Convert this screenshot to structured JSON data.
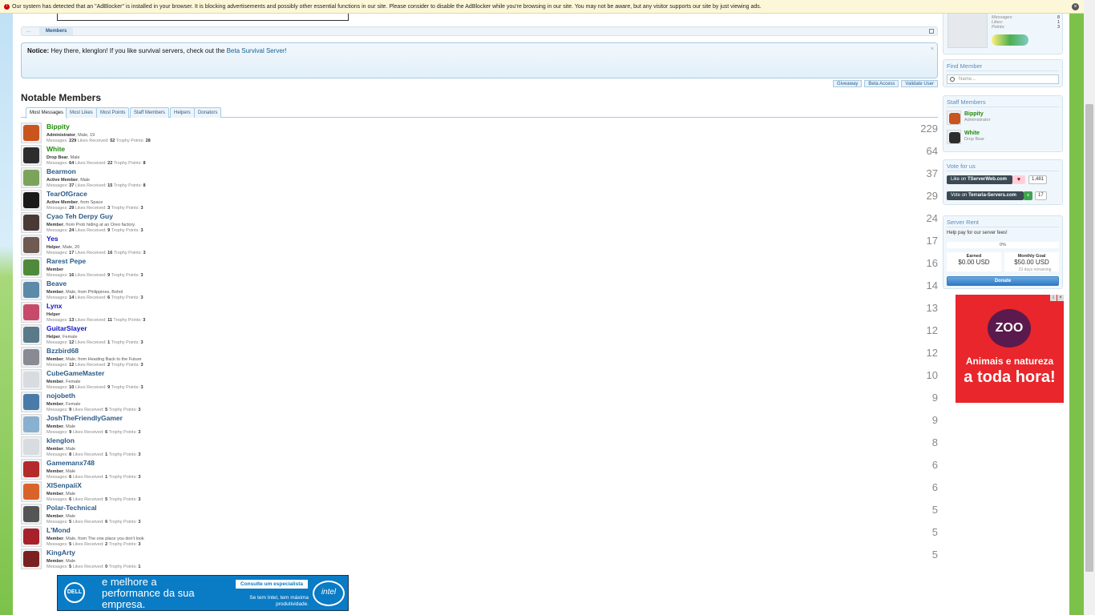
{
  "adblock_notice": "Our system has detected that an \"AdBlocker\" is installed in your browser. It is blocking advertisements and possibly other essential functions in our site. Please consider to disable the AdBlocker while you're browsing in our site. You may not be aware, but any visitor supports our site by just viewing ads.",
  "breadcrumb": {
    "home": "...",
    "current": "Members"
  },
  "notice": {
    "label": "Notice:",
    "text": "Hey there, klenglon! If you like survival servers, check out the",
    "link": "Beta Survival Server!"
  },
  "links": [
    "Giveaway",
    "Beta Access",
    "Validate User"
  ],
  "page_title": "Notable Members",
  "tabs": [
    "Most Messages",
    "Most Likes",
    "Most Points",
    "Staff Members",
    "Helpers",
    "Donators"
  ],
  "stat_labels": {
    "messages": "Messages:",
    "likes": "Likes Received:",
    "points": "Trophy Points:"
  },
  "members": [
    {
      "name": "Bippity",
      "role": "admin",
      "title": "Administrator",
      "info": ", Male, 19",
      "messages": "229",
      "likes": "52",
      "points": "28",
      "score": "229",
      "color": "#c9541d"
    },
    {
      "name": "White",
      "role": "staff",
      "title": "Drop Bear",
      "info": ", Male",
      "messages": "64",
      "likes": "22",
      "points": "8",
      "score": "64",
      "color": "#2d2d2d"
    },
    {
      "name": "Bearmon",
      "role": "member",
      "title": "Active Member",
      "info": ", Male",
      "messages": "37",
      "likes": "15",
      "points": "8",
      "score": "37",
      "color": "#7ba45a"
    },
    {
      "name": "TearOfGrace",
      "role": "member",
      "title": "Active Member",
      "info": ", from Space",
      "messages": "29",
      "likes": "3",
      "points": "3",
      "score": "29",
      "color": "#1a1a1a"
    },
    {
      "name": "Cyao Teh Derpy Guy",
      "role": "member",
      "title": "Member",
      "info": ", from Prob hiding at an Oreo factory.",
      "messages": "24",
      "likes": "9",
      "points": "3",
      "score": "24",
      "color": "#4a3a35"
    },
    {
      "name": "Yes",
      "role": "helper",
      "title": "Helper",
      "info": ", Male, 20",
      "messages": "17",
      "likes": "16",
      "points": "3",
      "score": "17",
      "color": "#6e5a52"
    },
    {
      "name": "Rarest Pepe",
      "role": "member",
      "title": "Member",
      "info": "",
      "messages": "16",
      "likes": "9",
      "points": "3",
      "score": "16",
      "color": "#4f8a3a"
    },
    {
      "name": "Beave",
      "role": "member",
      "title": "Member",
      "info": ", Male, from Philippines, Bohol",
      "messages": "14",
      "likes": "6",
      "points": "3",
      "score": "14",
      "color": "#5c8aa8"
    },
    {
      "name": "Lynx",
      "role": "helper",
      "title": "Helper",
      "info": "",
      "messages": "13",
      "likes": "11",
      "points": "3",
      "score": "13",
      "color": "#c84a6a"
    },
    {
      "name": "GuitarSlayer",
      "role": "helper",
      "title": "Helper",
      "info": ", Female",
      "messages": "12",
      "likes": "1",
      "points": "3",
      "score": "12",
      "color": "#5a7a8a"
    },
    {
      "name": "Bzzbird68",
      "role": "member",
      "title": "Member",
      "info": ", Male, from Heading Back to the Future",
      "messages": "12",
      "likes": "2",
      "points": "3",
      "score": "12",
      "color": "#8a8a95"
    },
    {
      "name": "CubeGameMaster",
      "role": "member",
      "title": "Member",
      "info": ", Female",
      "messages": "10",
      "likes": "9",
      "points": "3",
      "score": "10",
      "color": "#d8dce0"
    },
    {
      "name": "nojobeth",
      "role": "member",
      "title": "Member",
      "info": ", Female",
      "messages": "9",
      "likes": "5",
      "points": "3",
      "score": "9",
      "color": "#4a7aa8"
    },
    {
      "name": "JoshTheFriendlyGamer",
      "role": "member",
      "title": "Member",
      "info": ", Male",
      "messages": "9",
      "likes": "6",
      "points": "3",
      "score": "9",
      "color": "#8ab0cf"
    },
    {
      "name": "klenglon",
      "role": "member",
      "title": "Member",
      "info": ", Male",
      "messages": "8",
      "likes": "1",
      "points": "3",
      "score": "8",
      "color": "#d8dce0"
    },
    {
      "name": "Gamemanx748",
      "role": "member",
      "title": "Member",
      "info": ", Male",
      "messages": "6",
      "likes": "1",
      "points": "3",
      "score": "6",
      "color": "#b32b2b"
    },
    {
      "name": "XISenpaiiX",
      "role": "member",
      "title": "Member",
      "info": ", Male",
      "messages": "6",
      "likes": "5",
      "points": "3",
      "score": "6",
      "color": "#d8642a"
    },
    {
      "name": "Polar-Technical",
      "role": "member",
      "title": "Member",
      "info": ", Male",
      "messages": "5",
      "likes": "6",
      "points": "3",
      "score": "5",
      "color": "#555555"
    },
    {
      "name": "L'Mond",
      "role": "member",
      "title": "Member",
      "info": ", Male, from The one place you don't look",
      "messages": "5",
      "likes": "2",
      "points": "3",
      "score": "5",
      "color": "#a8202a"
    },
    {
      "name": "KingArty",
      "role": "member",
      "title": "Member",
      "info": ", Male",
      "messages": "5",
      "likes": "0",
      "points": "1",
      "score": "5",
      "color": "#7a2020"
    }
  ],
  "profile": {
    "stats": [
      {
        "label": "Messages:",
        "value": "8"
      },
      {
        "label": "Likes:",
        "value": "1"
      },
      {
        "label": "Points:",
        "value": "3"
      }
    ]
  },
  "find_member": {
    "title": "Find Member",
    "placeholder": "Name..."
  },
  "staff_members": {
    "title": "Staff Members",
    "items": [
      {
        "name": "Bippity",
        "title": "Administrator",
        "color": "#c9541d"
      },
      {
        "name": "White",
        "title": "Drop Bear",
        "color": "#2d2d2d"
      }
    ]
  },
  "vote": {
    "title": "Vote for us",
    "tserver": {
      "prefix": "Like on ",
      "site": "TServerWeb.com",
      "count": "1,481"
    },
    "terraria": {
      "prefix": "Vote on ",
      "site": "Terraria-Servers.com",
      "count": "17"
    }
  },
  "server_rent": {
    "title": "Server Rent",
    "subtitle": "Help pay for our server fees!",
    "progress_text": "0%",
    "progress": 0,
    "earned_label": "Earned",
    "earned_value": "$0.00 USD",
    "goal_label": "Monthly Goal",
    "goal_value": "$50.00 USD",
    "days_remaining": "23 days remaining",
    "donate_label": "Donate"
  },
  "ad_right": {
    "brand": "ZOO",
    "line1": "Animais e natureza",
    "line2": "a toda hora!"
  },
  "ad_bottom": {
    "logo": "DELL",
    "headline": "e melhore a performance da sua empresa.",
    "cta": "Consulte um especialista",
    "sub": "Se tem Intel, tem máxima produtividade.",
    "intel": "intel"
  }
}
